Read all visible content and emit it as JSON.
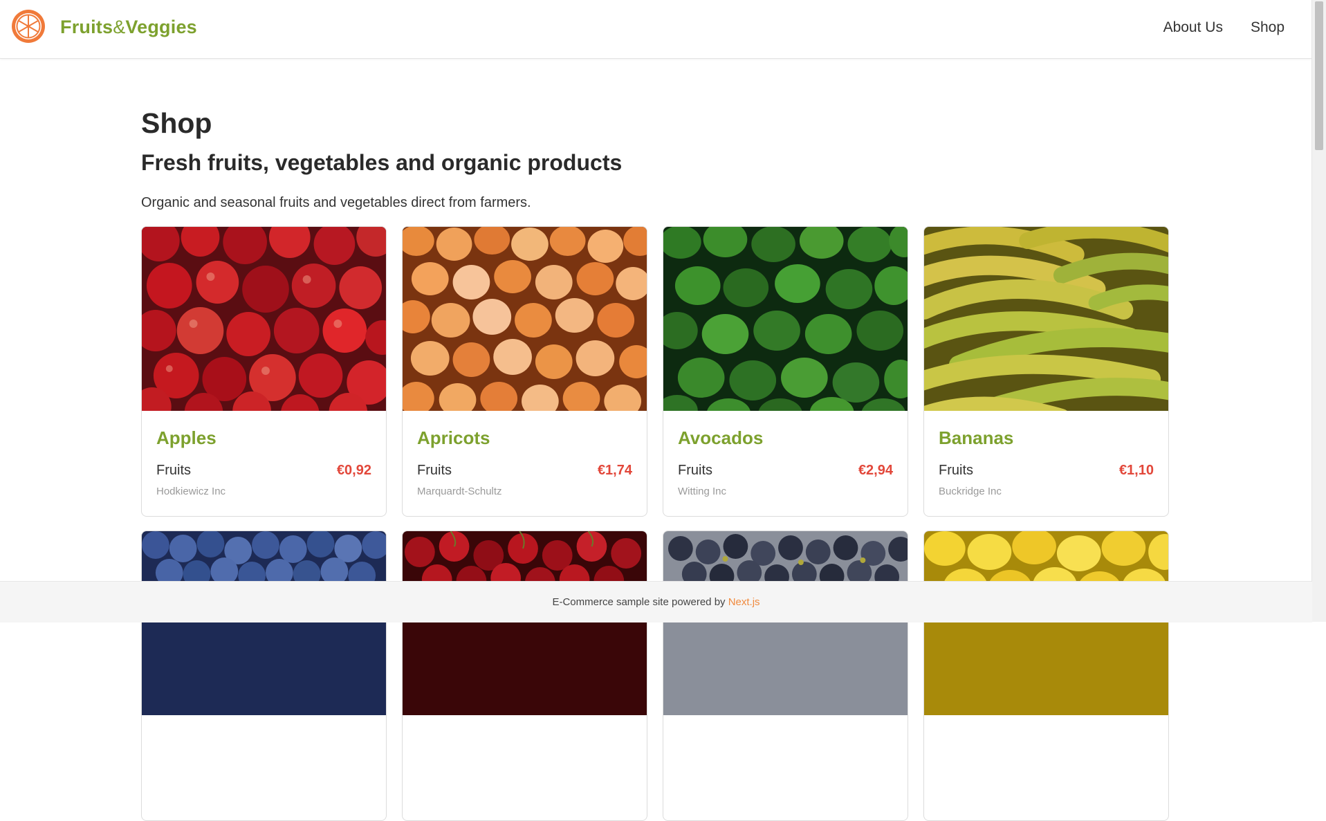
{
  "header": {
    "brand_part1": "Fruits",
    "brand_amp": "&",
    "brand_part2": "Veggies",
    "nav": [
      {
        "label": "About Us"
      },
      {
        "label": "Shop"
      }
    ]
  },
  "main": {
    "title": "Shop",
    "subtitle": "Fresh fruits, vegetables and organic products",
    "description": "Organic and seasonal fruits and vegetables direct from farmers."
  },
  "products": [
    {
      "name": "Apples",
      "category": "Fruits",
      "price": "€0,92",
      "vendor": "Hodkiewicz Inc"
    },
    {
      "name": "Apricots",
      "category": "Fruits",
      "price": "€1,74",
      "vendor": "Marquardt-Schultz"
    },
    {
      "name": "Avocados",
      "category": "Fruits",
      "price": "€2,94",
      "vendor": "Witting Inc"
    },
    {
      "name": "Bananas",
      "category": "Fruits",
      "price": "€1,10",
      "vendor": "Buckridge Inc"
    }
  ],
  "footer": {
    "text": "E-Commerce sample site powered by ",
    "link_label": "Next.js"
  },
  "colors": {
    "brand_green": "#7da12e",
    "price_red": "#e2473a",
    "logo_orange": "#f07a3a",
    "footer_link": "#f08a3e"
  },
  "icons": {
    "logo": "orange-slice-icon"
  }
}
